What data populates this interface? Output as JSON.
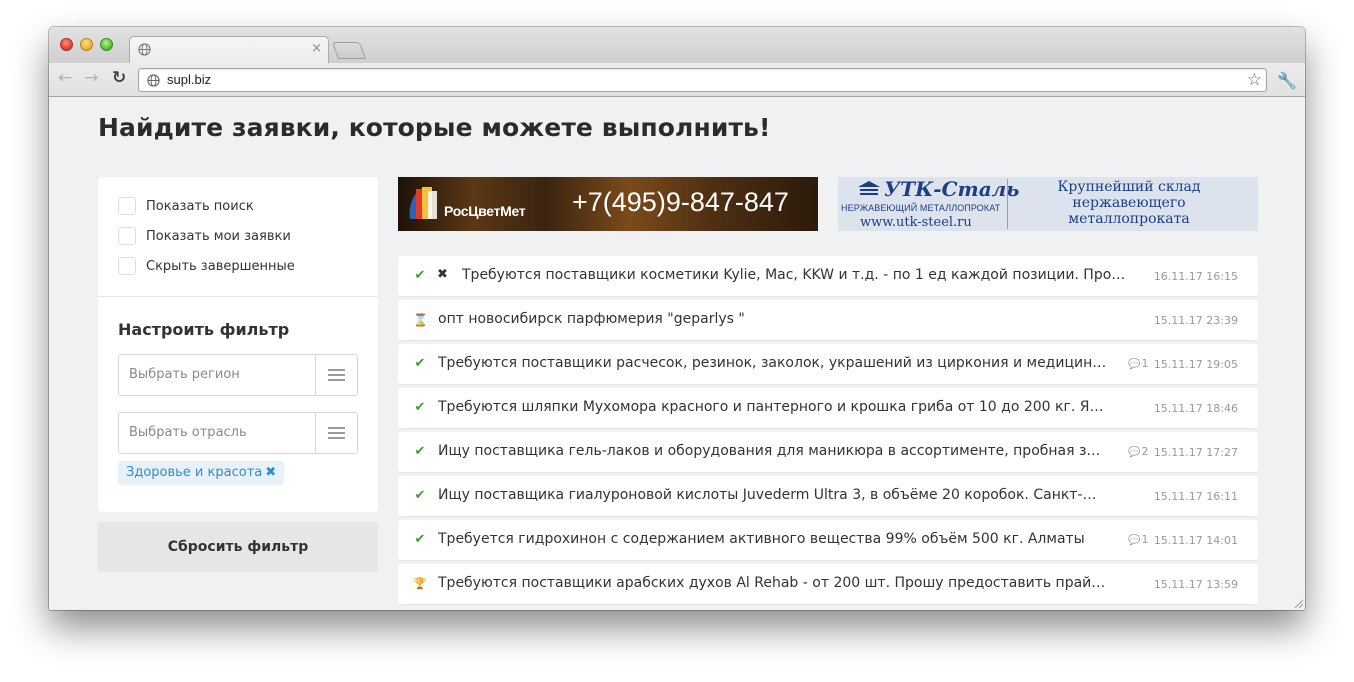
{
  "browser": {
    "url": "supl.biz",
    "tab_close": "×"
  },
  "page": {
    "title": "Найдите заявки, которые можете выполнить!"
  },
  "filters": {
    "checkboxes": [
      {
        "label": "Показать поиск",
        "checked": false
      },
      {
        "label": "Показать мои заявки",
        "checked": false
      },
      {
        "label": "Скрыть завершенные",
        "checked": false
      }
    ],
    "heading": "Настроить фильтр",
    "region_placeholder": "Выбрать регион",
    "industry_placeholder": "Выбрать отрасль",
    "active_tag": "Здоровье и красота",
    "reset_label": "Сбросить фильтр"
  },
  "banners": {
    "left": {
      "logo": "РосЦветМет",
      "phone": "+7(495)9-847-847"
    },
    "right": {
      "brand": "УТК-Сталь",
      "subtitle": "НЕРЖАВЕЮЩИЙ МЕТАЛЛОПРОКАТ",
      "site": "www.utk-steel.ru",
      "slogan": [
        "Крупнейший склад",
        "нержавеющего",
        "металлопроката"
      ]
    }
  },
  "requests": [
    {
      "status": "done",
      "closed": true,
      "title": "Требуются поставщики косметики Kylie, Mac, KKW и т.д. - по 1 ед каждой позиции. Прошу…",
      "comments": "",
      "date": "16.11.17 16:15"
    },
    {
      "status": "pending",
      "closed": false,
      "title": "опт новосибирск парфюмерия \"geparlys \"",
      "comments": "",
      "date": "15.11.17 23:39"
    },
    {
      "status": "done",
      "closed": false,
      "title": "Требуются поставщики расчесок, резинок, заколок, украшений из циркония и медицин…",
      "comments": "1",
      "date": "15.11.17 19:05"
    },
    {
      "status": "done",
      "closed": false,
      "title": "Требуются шляпки Мухомора красного и пантерного и крошка гриба от 10 до 200 кг. Я…",
      "comments": "",
      "date": "15.11.17 18:46"
    },
    {
      "status": "done",
      "closed": false,
      "title": "Ищу поставщика гель-лаков и оборудования для маникюра в ассортименте, пробная з…",
      "comments": "2",
      "date": "15.11.17 17:27"
    },
    {
      "status": "done",
      "closed": false,
      "title": "Ищу поставщика гиалуроновой кислоты Juvederm Ultra 3, в объёме 20 коробок. Санкт-…",
      "comments": "",
      "date": "15.11.17 16:11"
    },
    {
      "status": "done",
      "closed": false,
      "title": "Требуется гидрохинон с содержанием активного вещества 99% объём 500 кг. Алматы",
      "comments": "1",
      "date": "15.11.17 14:01"
    },
    {
      "status": "trophy",
      "closed": false,
      "title": "Требуются поставщики арабских духов Al Rehab - от 200 шт. Прошу предоставить прай…",
      "comments": "",
      "date": "15.11.17 13:59"
    }
  ],
  "colors": {
    "accent_link": "#2e8fd0",
    "status_done": "#3f9a2e",
    "status_pending": "#3ca2d8",
    "status_trophy": "#e0892a",
    "page_bg": "#f0f1f3"
  },
  "icons": {
    "done": "check-icon",
    "pending": "hourglass-icon",
    "trophy": "trophy-icon",
    "closed": "cross-icon",
    "comments": "comment-bubble-icon"
  }
}
